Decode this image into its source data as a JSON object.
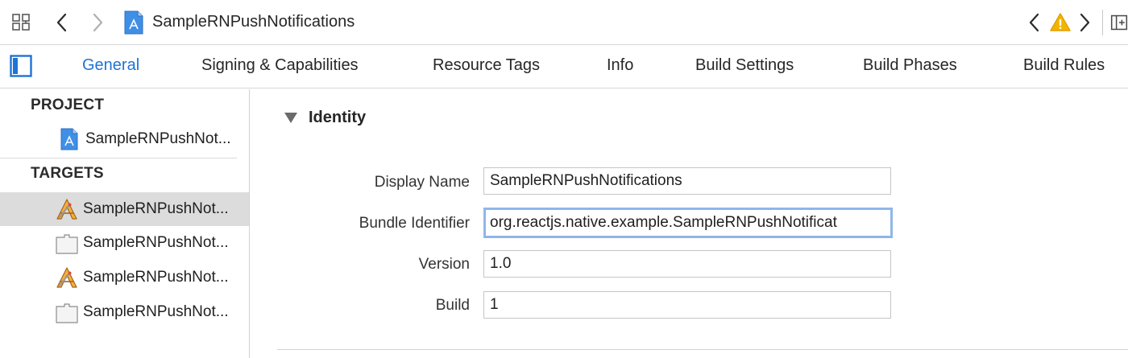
{
  "toolbar": {
    "breadcrumb": "SampleRNPushNotifications",
    "icons": {
      "grid": "related-items-grid-icon",
      "back": "chevron-left-icon",
      "forward": "chevron-right-icon",
      "file": "xcode-project-icon",
      "issue_prev": "chevron-left-icon",
      "warning": "warning-triangle-icon",
      "issue_next": "chevron-right-icon",
      "inspector": "split-editor-icon"
    }
  },
  "tabs": [
    {
      "label": "General",
      "active": true
    },
    {
      "label": "Signing & Capabilities",
      "active": false
    },
    {
      "label": "Resource Tags",
      "active": false
    },
    {
      "label": "Info",
      "active": false
    },
    {
      "label": "Build Settings",
      "active": false
    },
    {
      "label": "Build Phases",
      "active": false
    },
    {
      "label": "Build Rules",
      "active": false
    }
  ],
  "sidebar": {
    "project_header": "PROJECT",
    "project_item": "SampleRNPushNot...",
    "targets_header": "TARGETS",
    "targets": [
      {
        "label": "SampleRNPushNot...",
        "icon": "app-target-icon",
        "selected": true
      },
      {
        "label": "SampleRNPushNot...",
        "icon": "test-bundle-icon",
        "selected": false
      },
      {
        "label": "SampleRNPushNot...",
        "icon": "app-target-icon",
        "selected": false
      },
      {
        "label": "SampleRNPushNot...",
        "icon": "test-bundle-icon",
        "selected": false
      }
    ]
  },
  "identity": {
    "title": "Identity",
    "display_name_label": "Display Name",
    "display_name_value": "SampleRNPushNotifications",
    "bundle_id_label": "Bundle Identifier",
    "bundle_id_value": "org.reactjs.native.example.SampleRNPushNotificat",
    "version_label": "Version",
    "version_value": "1.0",
    "build_label": "Build",
    "build_value": "1"
  },
  "colors": {
    "accent": "#1f73d6",
    "warning": "#f5b400",
    "selection": "#dcdcdc",
    "focus_ring": "#8fb6ea"
  }
}
